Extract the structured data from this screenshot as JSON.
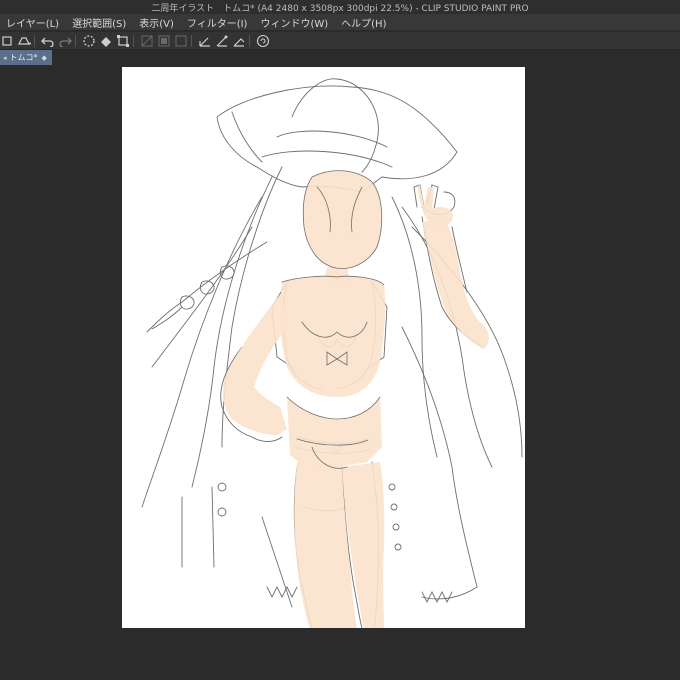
{
  "window": {
    "title": "二周年イラスト　トムコ* (A4 2480 x 3508px 300dpi 22.5%)  - CLIP STUDIO PAINT PRO"
  },
  "menu": {
    "items": [
      {
        "label": "レイヤー(L)"
      },
      {
        "label": "選択範囲(S)"
      },
      {
        "label": "表示(V)"
      },
      {
        "label": "フィルター(I)"
      },
      {
        "label": "ウィンドウ(W)"
      },
      {
        "label": "ヘルプ(H)"
      }
    ]
  },
  "toolbar": {
    "icons": [
      "save-icon",
      "print-icon",
      "undo-icon",
      "redo-icon",
      "loading-icon",
      "fill-icon",
      "transform-icon",
      "clear-icon",
      "invert-icon",
      "select-all-icon",
      "pen-icon",
      "brush-icon",
      "eraser-icon",
      "spiral-icon"
    ]
  },
  "document": {
    "tab_label": "トムコ*",
    "tab_close": "◆"
  },
  "colors": {
    "skin": "#fbe2cc",
    "line": "#6e6e6e",
    "paper": "#ffffff",
    "tab_active": "#5c6f8a"
  }
}
